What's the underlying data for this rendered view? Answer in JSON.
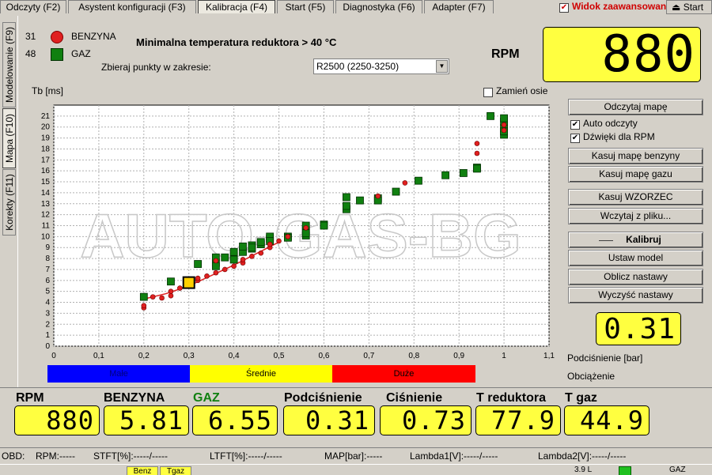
{
  "tabs": [
    {
      "label": "Odczyty (F2)"
    },
    {
      "label": "Asystent konfiguracji (F3)"
    },
    {
      "label": "Kalibracja (F4)"
    },
    {
      "label": "Start (F5)"
    },
    {
      "label": "Diagnostyka (F6)"
    },
    {
      "label": "Adapter (F7)"
    }
  ],
  "advanced_view_label": "Widok zaawansowany",
  "start_label": "Start",
  "vtabs": [
    {
      "label": "Modelowanie (F9)"
    },
    {
      "label": "Mapa (F10)"
    },
    {
      "label": "Korekty (F11)"
    }
  ],
  "legend": {
    "benzyna_count": "31",
    "benzyna_label": "BENZYNA",
    "gaz_count": "48",
    "gaz_label": "GAZ"
  },
  "condition": "Minimalna temperatura reduktora > 40 °C",
  "range_label": "Zbieraj punkty w zakresie:",
  "range_value": "R2500 (2250-3250)",
  "rpm_label": "RPM",
  "rpm_big": "880",
  "swap_axes_label": "Zamień osie",
  "y_axis_label": "Tb [ms]",
  "load_bands": [
    {
      "label": "Małe",
      "color": "#0000ff"
    },
    {
      "label": "Średnie",
      "color": "#ffff00"
    },
    {
      "label": "Duże",
      "color": "#ff0000"
    }
  ],
  "buttons": {
    "read_map": "Odczytaj mapę",
    "auto_read": "Auto odczyty",
    "rpm_sounds": "Dźwięki dla RPM",
    "clear_petrol": "Kasuj mapę benzyny",
    "clear_gas": "Kasuj mapę gazu",
    "clear_pattern": "Kasuj WZORZEC",
    "load_file": "Wczytaj z pliku...",
    "calibrate": "Kalibruj",
    "set_model": "Ustaw model",
    "compute": "Oblicz nastawy",
    "clear_settings": "Wyczyść nastawy"
  },
  "vacuum_value": "0.31",
  "vacuum_label": "Podciśnienie [bar]",
  "load_label": "Obciążenie",
  "watermark": "AUTO-GAS-BG",
  "bottom": {
    "labels": [
      "RPM",
      "BENZYNA",
      "GAZ",
      "Podciśnienie",
      "Ciśnienie",
      "T reduktora",
      "T gaz"
    ],
    "values": [
      "880",
      "5.81",
      "6.55",
      "0.31",
      "0.73",
      "77.9",
      "44.9"
    ]
  },
  "obd": {
    "obd": "OBD:",
    "rpm": "RPM:-----",
    "stft": "STFT[%]:-----/-----",
    "ltft": "LTFT[%]:-----/-----",
    "map": "MAP[bar]:-----",
    "l1": "Lambda1[V]:-----/-----",
    "l2": "Lambda2[V]:-----/-----"
  },
  "status": {
    "petrol_btn": "Benz",
    "gas_btn": "Tgaz",
    "voltage": "3.9 L",
    "fuel": "GAZ"
  },
  "chart_data": {
    "type": "scatter",
    "xlim": [
      0,
      1.1
    ],
    "ylim": [
      0,
      22
    ],
    "xticks": [
      0,
      0.1,
      0.2,
      0.3,
      0.4,
      0.5,
      0.6,
      0.7,
      0.8,
      0.9,
      1,
      1.1
    ],
    "yticks": [
      0,
      1,
      2,
      3,
      4,
      5,
      6,
      7,
      8,
      9,
      10,
      11,
      12,
      13,
      14,
      15,
      16,
      17,
      18,
      19,
      20,
      21
    ],
    "ylabel": "Tb [ms]",
    "grid": true,
    "series": [
      {
        "name": "BENZYNA",
        "color": "#e02020",
        "marker": "circle",
        "points": [
          [
            0.2,
            3.5
          ],
          [
            0.2,
            3.7
          ],
          [
            0.22,
            4.5
          ],
          [
            0.24,
            4.4
          ],
          [
            0.26,
            4.6
          ],
          [
            0.26,
            5.0
          ],
          [
            0.28,
            5.3
          ],
          [
            0.3,
            5.5
          ],
          [
            0.3,
            5.8
          ],
          [
            0.32,
            6.0
          ],
          [
            0.32,
            6.2
          ],
          [
            0.34,
            6.4
          ],
          [
            0.36,
            6.7
          ],
          [
            0.38,
            7.0
          ],
          [
            0.4,
            7.3
          ],
          [
            0.42,
            7.6
          ],
          [
            0.42,
            7.9
          ],
          [
            0.44,
            8.2
          ],
          [
            0.46,
            8.5
          ],
          [
            0.48,
            9.0
          ],
          [
            0.48,
            9.3
          ],
          [
            0.5,
            9.6
          ],
          [
            0.52,
            10.0
          ],
          [
            0.56,
            10.8
          ],
          [
            0.72,
            13.7
          ],
          [
            0.78,
            14.9
          ],
          [
            0.94,
            17.6
          ],
          [
            0.94,
            18.5
          ],
          [
            1.0,
            19.7
          ],
          [
            1.0,
            20.2
          ],
          [
            0.36,
            7.8
          ]
        ]
      },
      {
        "name": "GAZ",
        "color": "#108010",
        "marker": "square",
        "points": [
          [
            0.2,
            4.5
          ],
          [
            0.26,
            5.9
          ],
          [
            0.3,
            6.0
          ],
          [
            0.32,
            7.5
          ],
          [
            0.36,
            7.6
          ],
          [
            0.36,
            8.1
          ],
          [
            0.38,
            8.1
          ],
          [
            0.4,
            8.2
          ],
          [
            0.4,
            8.6
          ],
          [
            0.42,
            8.6
          ],
          [
            0.42,
            9.1
          ],
          [
            0.44,
            8.9
          ],
          [
            0.44,
            9.2
          ],
          [
            0.46,
            9.3
          ],
          [
            0.46,
            9.5
          ],
          [
            0.48,
            9.8
          ],
          [
            0.48,
            10.0
          ],
          [
            0.52,
            10.0
          ],
          [
            0.56,
            10.1
          ],
          [
            0.56,
            10.6
          ],
          [
            0.56,
            11.0
          ],
          [
            0.6,
            11.1
          ],
          [
            0.65,
            12.5
          ],
          [
            0.65,
            13.6
          ],
          [
            0.68,
            13.3
          ],
          [
            0.72,
            13.5
          ],
          [
            0.76,
            14.1
          ],
          [
            0.81,
            15.1
          ],
          [
            0.87,
            15.6
          ],
          [
            0.91,
            15.8
          ],
          [
            0.94,
            16.3
          ],
          [
            0.97,
            21.0
          ],
          [
            1.0,
            19.3
          ],
          [
            1.0,
            19.9
          ],
          [
            1.0,
            20.5
          ],
          [
            1.0,
            20.8
          ],
          [
            0.36,
            7.3
          ],
          [
            0.4,
            7.9
          ],
          [
            0.52,
            9.9
          ],
          [
            0.65,
            12.8
          ],
          [
            0.3,
            5.9
          ],
          [
            0.44,
            9.0
          ],
          [
            0.48,
            9.6
          ],
          [
            0.56,
            10.3
          ],
          [
            0.6,
            11.0
          ],
          [
            0.72,
            13.3
          ],
          [
            0.94,
            16.2
          ],
          [
            1.0,
            19.6
          ]
        ]
      }
    ],
    "regression_line": [
      [
        0.2,
        4.3
      ],
      [
        0.25,
        4.8
      ],
      [
        0.3,
        5.5
      ],
      [
        0.4,
        7.4
      ],
      [
        0.5,
        9.5
      ]
    ],
    "current_point": [
      0.3,
      5.8
    ]
  }
}
